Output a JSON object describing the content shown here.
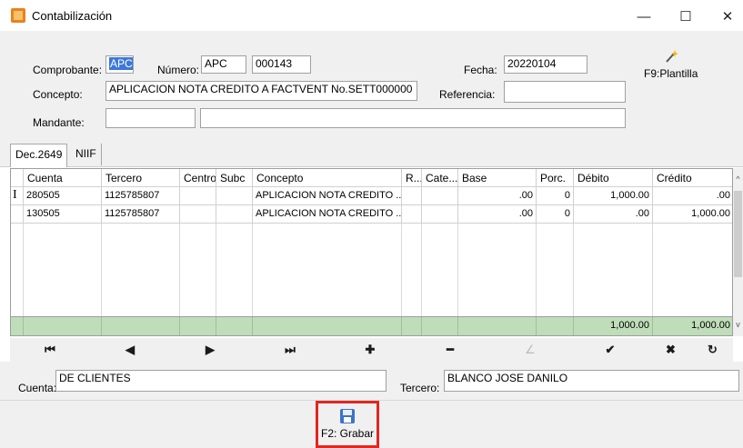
{
  "window": {
    "title": "Contabilización",
    "minimize": "—",
    "maximize": "☐",
    "close": "✕"
  },
  "form": {
    "comprobante_label": "Comprobante:",
    "comprobante_value": "APC",
    "numero_label": "Número:",
    "numero_prefix": "APC",
    "numero_value": "000143",
    "fecha_label": "Fecha:",
    "fecha_value": "20220104",
    "concepto_label": "Concepto:",
    "concepto_value": "APLICACION NOTA CREDITO A FACTVENT No.SETT000000",
    "referencia_label": "Referencia:",
    "referencia_value": "",
    "mandante_label": "Mandante:",
    "mandante_code": "",
    "mandante_name": "",
    "plantilla_label": "F9:Plantilla",
    "plantilla_icon": "magic-wand-icon"
  },
  "tabs": [
    {
      "label": "Dec.2649",
      "active": true
    },
    {
      "label": "NIIF",
      "active": false
    }
  ],
  "grid": {
    "headers": [
      "Cuenta",
      "Tercero",
      "Centro",
      "Subc",
      "Concepto",
      "R...",
      "Cate...",
      "Base",
      "Porc.",
      "Débito",
      "Crédito"
    ],
    "rows": [
      {
        "marker": "I",
        "cuenta": "280505",
        "tercero": "1125785807",
        "centro": "",
        "subc": "",
        "concepto": "APLICACION NOTA CREDITO ...",
        "r": "",
        "cate": "",
        "base": ".00",
        "porc": "0",
        "debito": "1,000.00",
        "credito": ".00"
      },
      {
        "marker": "",
        "cuenta": "130505",
        "tercero": "1125785807",
        "centro": "",
        "subc": "",
        "concepto": "APLICACION NOTA CREDITO ...",
        "r": "",
        "cate": "",
        "base": ".00",
        "porc": "0",
        "debito": ".00",
        "credito": "1,000.00"
      }
    ],
    "totals": {
      "debito": "1,000.00",
      "credito": "1,000.00"
    }
  },
  "nav": {
    "first": "⏮",
    "prev": "◀",
    "next": "▶",
    "last": "⏭",
    "add": "✚",
    "delete": "━",
    "edit": "∠",
    "confirm": "✔",
    "cancel": "✖",
    "refresh": "↻"
  },
  "bottom": {
    "cuenta_label": "Cuenta:",
    "cuenta_value": "DE CLIENTES",
    "tercero_label": "Tercero:",
    "tercero_value": "BLANCO JOSE DANILO"
  },
  "actions": {
    "save_label": "F2: Grabar",
    "save_icon": "floppy-disk-icon",
    "highlight_color": "#e3261f"
  }
}
